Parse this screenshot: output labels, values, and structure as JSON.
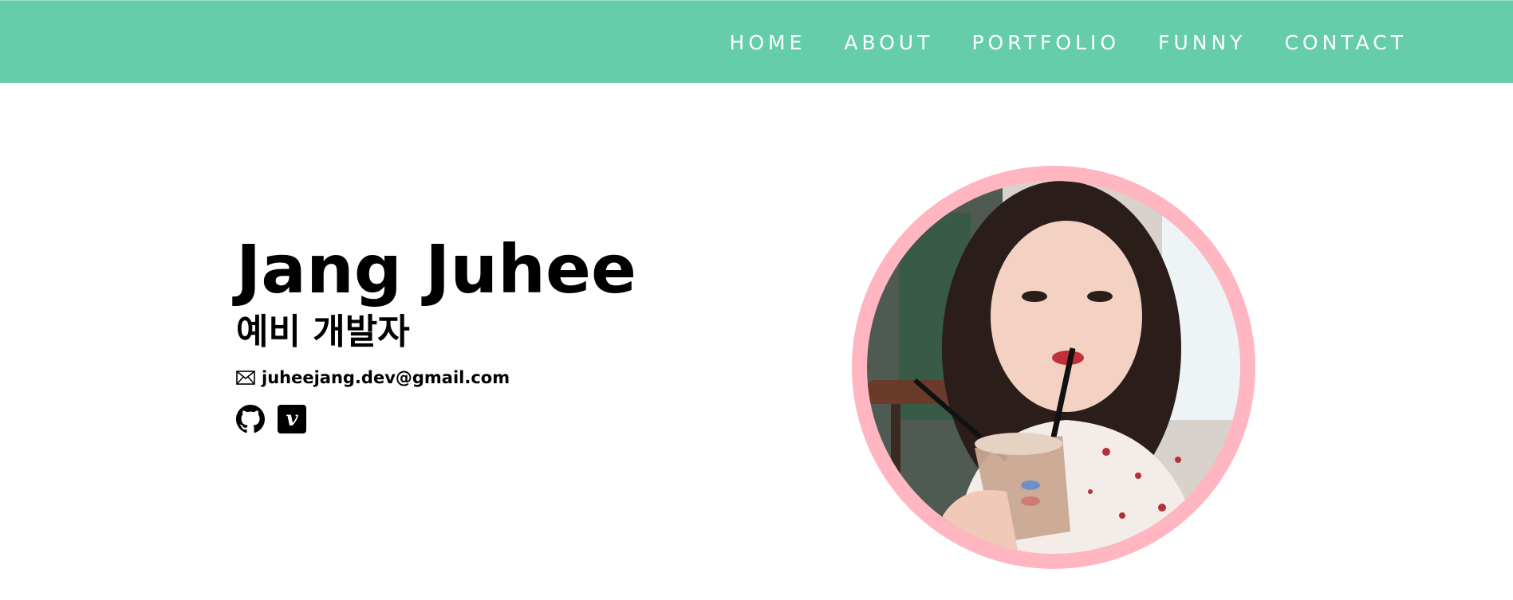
{
  "nav": {
    "items": [
      "HOME",
      "ABOUT",
      "PORTFOLIO",
      "FUNNY",
      "CONTACT"
    ]
  },
  "hero": {
    "name": "Jang Juhee",
    "subtitle": "예비 개발자",
    "email": "juheejang.dev@gmail.com",
    "social_icons": [
      "github-icon",
      "vimeo-icon"
    ]
  },
  "colors": {
    "navbar": "#66cdaa",
    "profile_ring": "#ffb6c1",
    "text": "#000000"
  }
}
